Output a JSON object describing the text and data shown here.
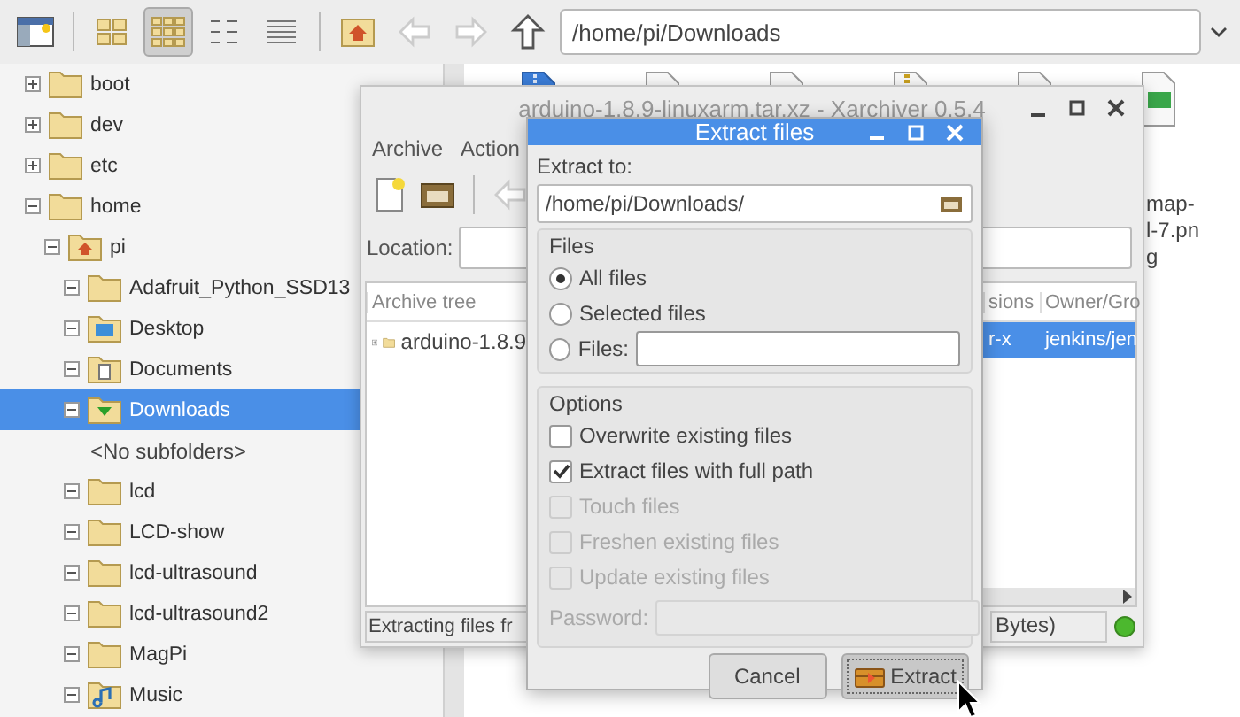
{
  "toolbar": {
    "view_modes": [
      {
        "selected": false
      },
      {
        "selected": true
      },
      {
        "selected": false
      },
      {
        "selected": false
      }
    ],
    "address": "/home/pi/Downloads"
  },
  "tree": [
    {
      "label": "boot",
      "kind": "folder",
      "expanded": false,
      "selected": false
    },
    {
      "label": "dev",
      "kind": "folder",
      "expanded": false,
      "selected": false
    },
    {
      "label": "etc",
      "kind": "folder",
      "expanded": false,
      "selected": false
    },
    {
      "label": "home",
      "kind": "folder",
      "expanded": true,
      "selected": false,
      "children": [
        {
          "label": "pi",
          "kind": "home",
          "expanded": true,
          "selected": false,
          "children": [
            {
              "label": "Adafruit_Python_SSD13",
              "kind": "folder",
              "expanded": true,
              "selected": false
            },
            {
              "label": "Desktop",
              "kind": "desktop",
              "expanded": true,
              "selected": false
            },
            {
              "label": "Documents",
              "kind": "documents",
              "expanded": true,
              "selected": false
            },
            {
              "label": "Downloads",
              "kind": "downloads",
              "expanded": true,
              "selected": true,
              "children": [
                {
                  "label": "<No subfolders>",
                  "kind": "placeholder"
                }
              ]
            },
            {
              "label": "lcd",
              "kind": "folder",
              "expanded": true,
              "selected": false
            },
            {
              "label": "LCD-show",
              "kind": "folder",
              "expanded": true,
              "selected": false
            },
            {
              "label": "lcd-ultrasound",
              "kind": "folder",
              "expanded": true,
              "selected": false
            },
            {
              "label": "lcd-ultrasound2",
              "kind": "folder",
              "expanded": true,
              "selected": false
            },
            {
              "label": "MagPi",
              "kind": "folder",
              "expanded": true,
              "selected": false
            },
            {
              "label": "Music",
              "kind": "music",
              "expanded": true,
              "selected": false
            }
          ]
        }
      ]
    }
  ],
  "files": [
    {
      "kind": "package"
    },
    {
      "kind": "document"
    },
    {
      "kind": "document"
    },
    {
      "kind": "zip"
    },
    {
      "kind": "document"
    },
    {
      "kind": "image",
      "label_lines": [
        "map-",
        "l-7.pn",
        "g"
      ]
    }
  ],
  "xarchiver": {
    "title": "arduino-1.8.9-linuxarm.tar.xz - Xarchiver 0.5.4",
    "menu": [
      "Archive",
      "Action"
    ],
    "location_label": "Location:",
    "tree_header": "Archive tree",
    "tree_items": [
      {
        "label": "arduino-1.8.9",
        "expanded": false
      }
    ],
    "columns": [
      "sions",
      "Owner/Gro"
    ],
    "rows": [
      {
        "cells": [
          "r-x",
          "jenkins/jen"
        ],
        "selected": true
      }
    ],
    "status": "Extracting files fr",
    "size_status": "Bytes)"
  },
  "dialog": {
    "title": "Extract files",
    "extract_to_label": "Extract to:",
    "extract_to": "/home/pi/Downloads/",
    "files_label": "Files",
    "file_options": [
      {
        "label": "All files",
        "selected": true
      },
      {
        "label": "Selected files",
        "selected": false
      },
      {
        "label": "Files:",
        "selected": false
      }
    ],
    "options_label": "Options",
    "options": [
      {
        "label": "Overwrite existing files",
        "checked": false,
        "disabled": false
      },
      {
        "label": "Extract files with full path",
        "checked": true,
        "disabled": false
      },
      {
        "label": "Touch files",
        "checked": false,
        "disabled": true
      },
      {
        "label": "Freshen existing files",
        "checked": false,
        "disabled": true
      },
      {
        "label": "Update existing files",
        "checked": false,
        "disabled": true
      }
    ],
    "password": {
      "label": "Password:",
      "disabled": true
    },
    "buttons": [
      {
        "label": "Cancel",
        "kind": "plain",
        "focused": false
      },
      {
        "label": "Extract",
        "kind": "extract",
        "focused": true
      }
    ]
  }
}
